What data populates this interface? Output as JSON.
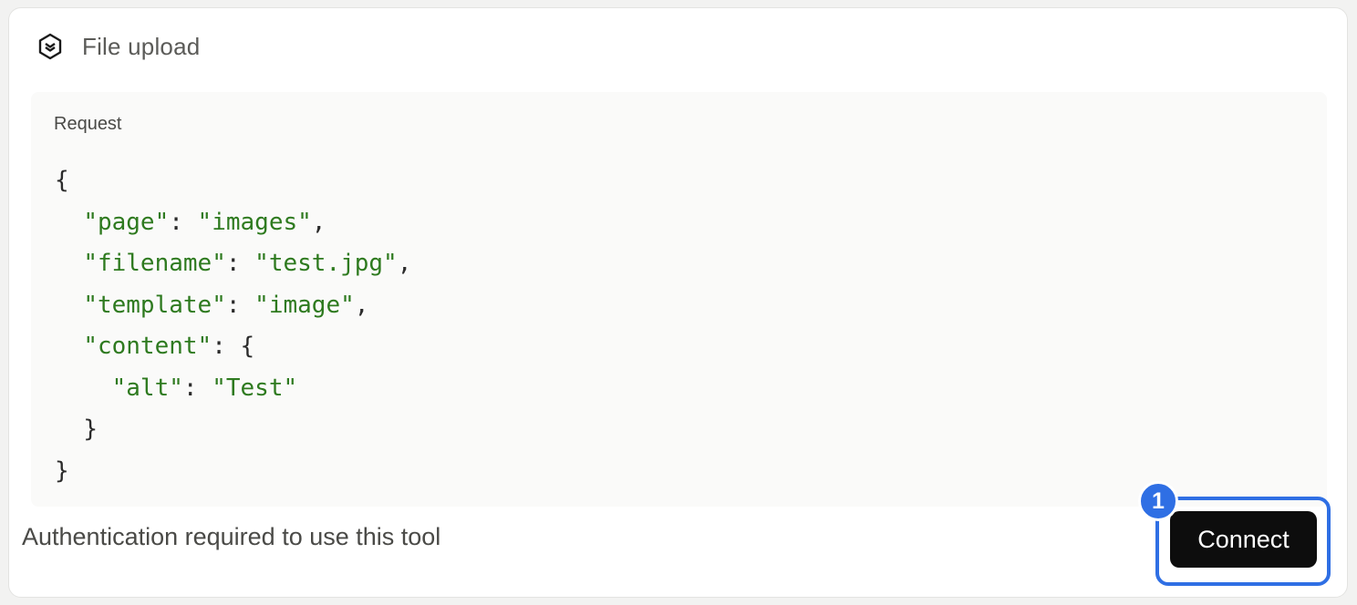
{
  "header": {
    "icon": "cube-icon",
    "title": "File upload"
  },
  "request": {
    "label": "Request",
    "code": {
      "open": "{",
      "page_key": "\"page\"",
      "page_val": "\"images\"",
      "filename_key": "\"filename\"",
      "filename_val": "\"test.jpg\"",
      "template_key": "\"template\"",
      "template_val": "\"image\"",
      "content_key": "\"content\"",
      "alt_key": "\"alt\"",
      "alt_val": "\"Test\"",
      "inner_close": "}",
      "close": "}"
    }
  },
  "footer": {
    "auth_text": "Authentication required to use this tool",
    "connect_label": "Connect",
    "step_number": "1"
  },
  "colors": {
    "accent": "#2f6fe4",
    "string": "#2e7a1f",
    "button_bg": "#0d0d0d"
  }
}
